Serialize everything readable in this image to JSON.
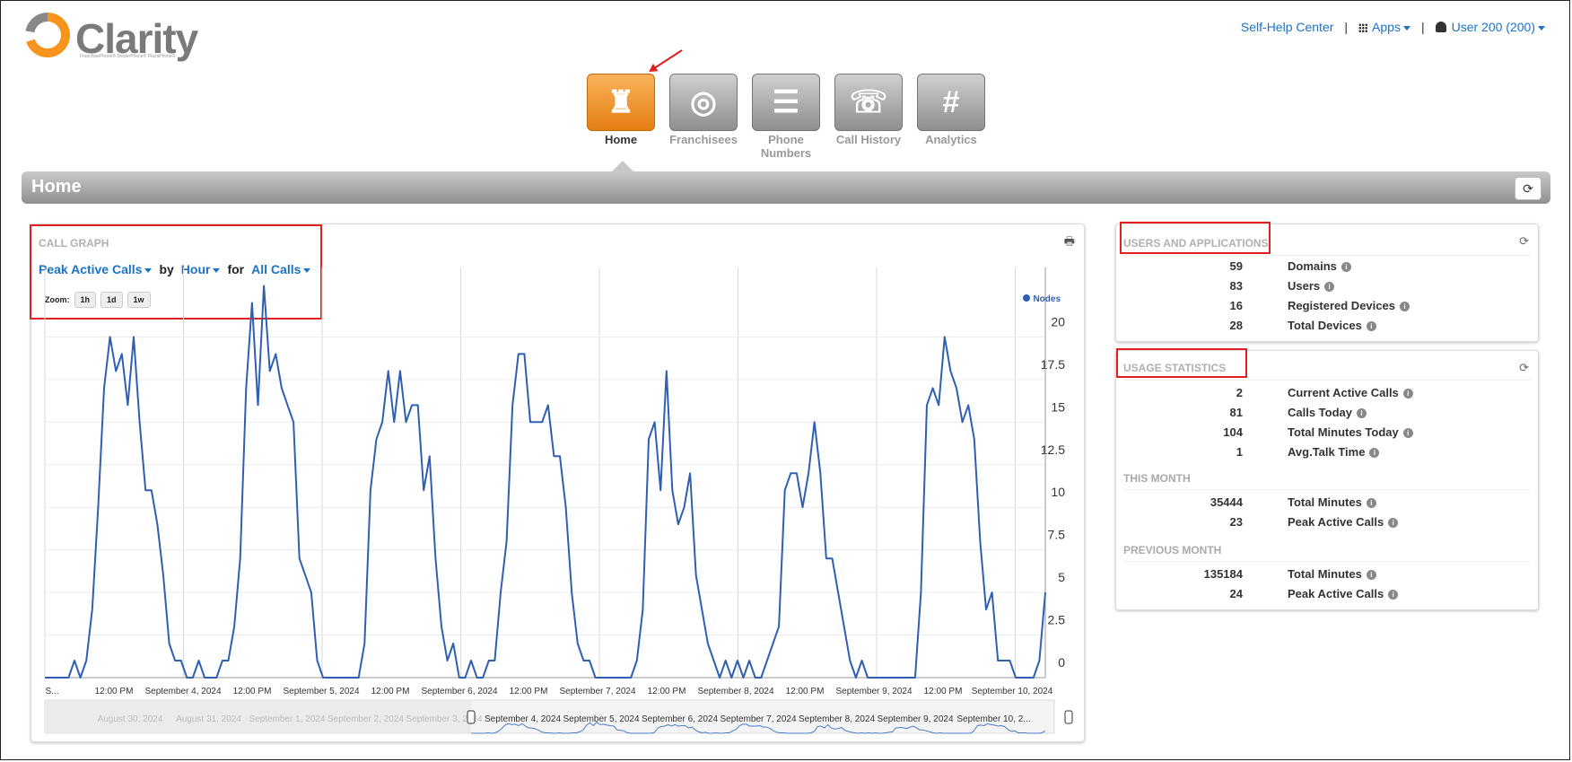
{
  "header": {
    "logo_text": "Clarity",
    "logo_subtext": "FranchisePhone® DealerPhone® PlazaPhone®",
    "links": {
      "help": "Self-Help Center",
      "apps": "Apps",
      "user": "User 200 (200)"
    }
  },
  "nav": {
    "items": [
      {
        "label": "Home",
        "icon": "castle-icon",
        "glyph": "♜"
      },
      {
        "label": "Franchisees",
        "icon": "group-icon",
        "glyph": "◎"
      },
      {
        "label": "Phone Numbers",
        "icon": "list-icon",
        "glyph": "☰"
      },
      {
        "label": "Call History",
        "icon": "phone-icon",
        "glyph": "☏"
      },
      {
        "label": "Analytics",
        "icon": "hash-icon",
        "glyph": "#"
      }
    ],
    "active": "Home"
  },
  "page": {
    "title": "Home",
    "refresh_icon": "refresh-icon"
  },
  "call_graph": {
    "title": "CALL GRAPH",
    "metric": "Peak Active Calls",
    "by_word": "by",
    "interval": "Hour",
    "for_word": "for",
    "filter": "All Calls",
    "zoom_label": "Zoom:",
    "zoom_buttons": [
      "1h",
      "1d",
      "1w"
    ],
    "legend": "Nodes",
    "accent": "#2f5fb3"
  },
  "chart_data": {
    "type": "line",
    "series_name": "Nodes",
    "y_ticks": [
      "20",
      "17.5",
      "15",
      "12.5",
      "10",
      "7.5",
      "5",
      "2.5",
      "0"
    ],
    "ylim": [
      0,
      22.5
    ],
    "x_ticks": [
      "S...",
      "12:00 PM",
      "September 4, 2024",
      "12:00 PM",
      "September 5, 2024",
      "12:00 PM",
      "September 6, 2024",
      "12:00 PM",
      "September 7, 2024",
      "12:00 PM",
      "September 8, 2024",
      "12:00 PM",
      "September 9, 2024",
      "12:00 PM",
      "September 10, 2024"
    ],
    "values": [
      0,
      0,
      0,
      0,
      0,
      1,
      0,
      1,
      4,
      10,
      17,
      20,
      18,
      19,
      16,
      20,
      15,
      11,
      11,
      9,
      6,
      2,
      1,
      1,
      0,
      0,
      1,
      0,
      0,
      0,
      1,
      1,
      3,
      7,
      17,
      22,
      16,
      23,
      18,
      19,
      17,
      16,
      15,
      7,
      6,
      5,
      1,
      0,
      0,
      0,
      0,
      0,
      0,
      0,
      2,
      11,
      14,
      15,
      18,
      15,
      18,
      15,
      16,
      16,
      11,
      13,
      7,
      3,
      1,
      2,
      0,
      0,
      1,
      0,
      0,
      1,
      1,
      5,
      8,
      16,
      19,
      19,
      15,
      15,
      15,
      16,
      13,
      13,
      10,
      5,
      2,
      1,
      1,
      0,
      0,
      0,
      0,
      0,
      0,
      0,
      1,
      4,
      14,
      15,
      11,
      18,
      11,
      9,
      10,
      12,
      6,
      4,
      2,
      1,
      0,
      1,
      0,
      1,
      0,
      1,
      0,
      0,
      1,
      2,
      3,
      11,
      12,
      12,
      10,
      12,
      15,
      12,
      7,
      7,
      5,
      3,
      1,
      0,
      1,
      0,
      0,
      0,
      0,
      0,
      0,
      0,
      0,
      0,
      5,
      16,
      17,
      16,
      20,
      18,
      17,
      15,
      16,
      14,
      8,
      4,
      5,
      1,
      1,
      1,
      0,
      0,
      0,
      0,
      1,
      5
    ],
    "navigator_labels": [
      "August 30, 2024",
      "August 31, 2024",
      "September 1, 2024",
      "September 2, 2024",
      "September 3, 2024",
      "September 4, 2024",
      "September 5, 2024",
      "September 6, 2024",
      "September 7, 2024",
      "September 8, 2024",
      "September 9, 2024",
      "September 10, 2..."
    ]
  },
  "users_apps": {
    "title": "USERS AND APPLICATIONS",
    "rows": [
      {
        "value": "59",
        "label": "Domains"
      },
      {
        "value": "83",
        "label": "Users"
      },
      {
        "value": "16",
        "label": "Registered Devices"
      },
      {
        "value": "28",
        "label": "Total Devices"
      }
    ]
  },
  "usage": {
    "title": "USAGE STATISTICS",
    "rows": [
      {
        "value": "2",
        "label": "Current Active Calls"
      },
      {
        "value": "81",
        "label": "Calls Today"
      },
      {
        "value": "104",
        "label": "Total Minutes Today"
      },
      {
        "value": "1",
        "label": "Avg.Talk Time"
      }
    ],
    "this_month_label": "THIS MONTH",
    "this_month": [
      {
        "value": "35444",
        "label": "Total Minutes"
      },
      {
        "value": "23",
        "label": "Peak Active Calls"
      }
    ],
    "prev_month_label": "PREVIOUS MONTH",
    "prev_month": [
      {
        "value": "135184",
        "label": "Total Minutes"
      },
      {
        "value": "24",
        "label": "Peak Active Calls"
      }
    ]
  }
}
